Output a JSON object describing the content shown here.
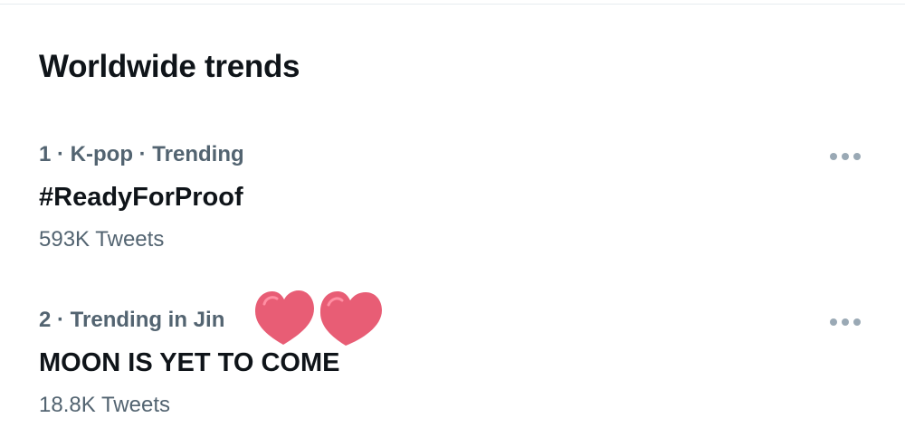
{
  "section": {
    "title": "Worldwide trends"
  },
  "trends": [
    {
      "meta": "1 · K-pop · Trending",
      "name": "#ReadyForProof",
      "count": "593K Tweets"
    },
    {
      "meta": "2 · Trending in Jin",
      "name": "MOON IS YET TO COME",
      "count": "18.8K Tweets"
    }
  ],
  "colors": {
    "heart": "#e85d75",
    "more_dots": "#9aa9b5",
    "secondary_text": "#536471",
    "primary_text": "#0f1419"
  },
  "icons": {
    "more": "more-horizontal-icon",
    "hearts": "heart-emoji-icon"
  }
}
